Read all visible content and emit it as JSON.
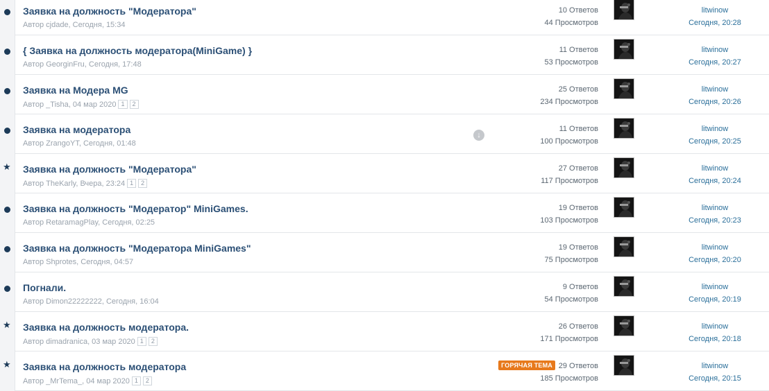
{
  "topics": [
    {
      "icon": "unread-dot-icon",
      "title": "Заявка на должность \"Модератора\"",
      "author_line": "Автор cjdade, Сегодня, 15:34",
      "pages": [],
      "replies": "10 Ответов",
      "views": "44 Просмотров",
      "last_user": "litwinow",
      "last_time": "Сегодня, 20:28"
    },
    {
      "icon": "unread-dot-icon",
      "title": "{ Заявка на должность модератора(MiniGame) }",
      "author_line": "Автор GeorginFru, Сегодня, 17:48",
      "pages": [],
      "replies": "11 Ответов",
      "views": "53 Просмотров",
      "last_user": "litwinow",
      "last_time": "Сегодня, 20:27"
    },
    {
      "icon": "unread-dot-icon",
      "title": "Заявка на Модера MG",
      "author_line": "Автор _Tisha, 04 мар 2020",
      "pages": [
        "1",
        "2"
      ],
      "replies": "25 Ответов",
      "views": "234 Просмотров",
      "last_user": "litwinow",
      "last_time": "Сегодня, 20:26"
    },
    {
      "icon": "unread-dot-icon",
      "title": "Заявка на модератора",
      "author_line": "Автор ZrangoYT, Сегодня, 01:48",
      "pages": [],
      "replies": "11 Ответов",
      "views": "100 Просмотров",
      "last_user": "litwinow",
      "last_time": "Сегодня, 20:25",
      "download_icon": "download-icon"
    },
    {
      "icon": "star-icon",
      "title": "Заявка на должность \"Модератора\"",
      "author_line": "Автор TheKarly, Вчера, 23:24",
      "pages": [
        "1",
        "2"
      ],
      "replies": "27 Ответов",
      "views": "117 Просмотров",
      "last_user": "litwinow",
      "last_time": "Сегодня, 20:24"
    },
    {
      "icon": "unread-dot-icon",
      "title": "Заявка на должность \"Модератор\" MiniGames.",
      "author_line": "Автор RetaramagPlay, Сегодня, 02:25",
      "pages": [],
      "replies": "19 Ответов",
      "views": "103 Просмотров",
      "last_user": "litwinow",
      "last_time": "Сегодня, 20:23"
    },
    {
      "icon": "unread-dot-icon",
      "title": "Заявка на должность \"Модератора MiniGames\"",
      "author_line": "Автор Shprotes, Сегодня, 04:57",
      "pages": [],
      "replies": "19 Ответов",
      "views": "75 Просмотров",
      "last_user": "litwinow",
      "last_time": "Сегодня, 20:20"
    },
    {
      "icon": "unread-dot-icon",
      "title": "Погнали.",
      "author_line": "Автор Dimon22222222, Сегодня, 16:04",
      "pages": [],
      "replies": "9 Ответов",
      "views": "54 Просмотров",
      "last_user": "litwinow",
      "last_time": "Сегодня, 20:19"
    },
    {
      "icon": "star-icon",
      "title": "Заявка на должность модератора.",
      "author_line": "Автор dimadranica, 03 мар 2020",
      "pages": [
        "1",
        "2"
      ],
      "replies": "26 Ответов",
      "views": "171 Просмотров",
      "last_user": "litwinow",
      "last_time": "Сегодня, 20:18"
    },
    {
      "icon": "star-icon",
      "title": "Заявка на должность модератора",
      "author_line": "Автор _MrTema_, 04 мар 2020",
      "pages": [
        "1",
        "2"
      ],
      "replies": "29 Ответов",
      "views": "185 Просмотров",
      "last_user": "litwinow",
      "last_time": "Сегодня, 20:15",
      "badge": "ГОРЯЧАЯ ТЕМА"
    }
  ],
  "colors": {
    "title": "#2b4f75",
    "badge_bg": "#e7791c",
    "icon": "#1c3a58"
  }
}
